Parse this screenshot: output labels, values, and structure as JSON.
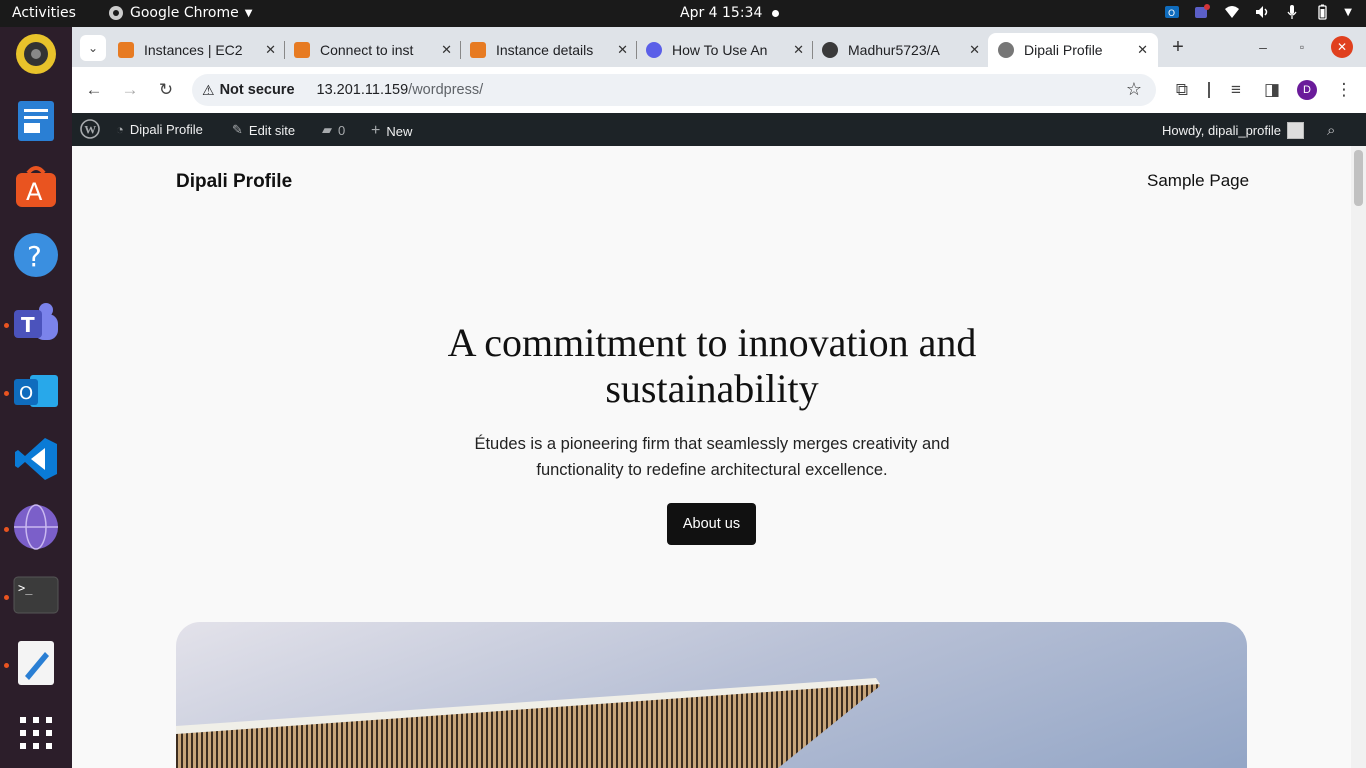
{
  "topbar": {
    "activities": "Activities",
    "app_name": "Google Chrome",
    "clock": "Apr 4  15:34"
  },
  "dock": {
    "items": [
      {
        "name": "rhythmbox",
        "icon": "speaker-icon"
      },
      {
        "name": "libreoffice-writer",
        "icon": "document-icon"
      },
      {
        "name": "ubuntu-software",
        "icon": "software-center-icon"
      },
      {
        "name": "help",
        "icon": "help-icon"
      },
      {
        "name": "teams",
        "icon": "teams-icon"
      },
      {
        "name": "outlook",
        "icon": "outlook-icon"
      },
      {
        "name": "vscode",
        "icon": "vscode-icon"
      },
      {
        "name": "browser",
        "icon": "globe-icon"
      },
      {
        "name": "terminal",
        "icon": "terminal-icon"
      },
      {
        "name": "text-editor",
        "icon": "text-editor-icon"
      },
      {
        "name": "show-apps",
        "icon": "app-grid-icon"
      }
    ]
  },
  "tabs": [
    {
      "label": "Instances | EC2",
      "favicon_color": "#e77b22"
    },
    {
      "label": "Connect to inst",
      "favicon_color": "#e77b22"
    },
    {
      "label": "Instance details",
      "favicon_color": "#e77b22"
    },
    {
      "label": "How To Use An",
      "favicon_color": "#5b5fe8"
    },
    {
      "label": "Madhur5723/A",
      "favicon_color": "#3a3a3a"
    },
    {
      "label": "Dipali Profile",
      "favicon_color": "#777777"
    }
  ],
  "toolbar": {
    "security_label": "Not secure",
    "url_host": "13.201.11.159",
    "url_path": "/wordpress/",
    "profile_initial": "D"
  },
  "adminbar": {
    "site_name": "Dipali Profile",
    "edit_site": "Edit site",
    "comments_count": "0",
    "new_label": "New",
    "howdy": "Howdy, dipali_profile"
  },
  "site": {
    "title": "Dipali Profile",
    "nav": [
      "Sample Page"
    ],
    "hero_title": "A commitment to innovation and sustainability",
    "hero_subtitle": "Études is a pioneering firm that seamlessly merges creativity and functionality to redefine architectural excellence.",
    "hero_button": "About us"
  },
  "colors": {
    "accent": "#e95420",
    "adminbar": "#1d2327",
    "page_bg": "#f9f9f9",
    "button_bg": "#111111"
  }
}
